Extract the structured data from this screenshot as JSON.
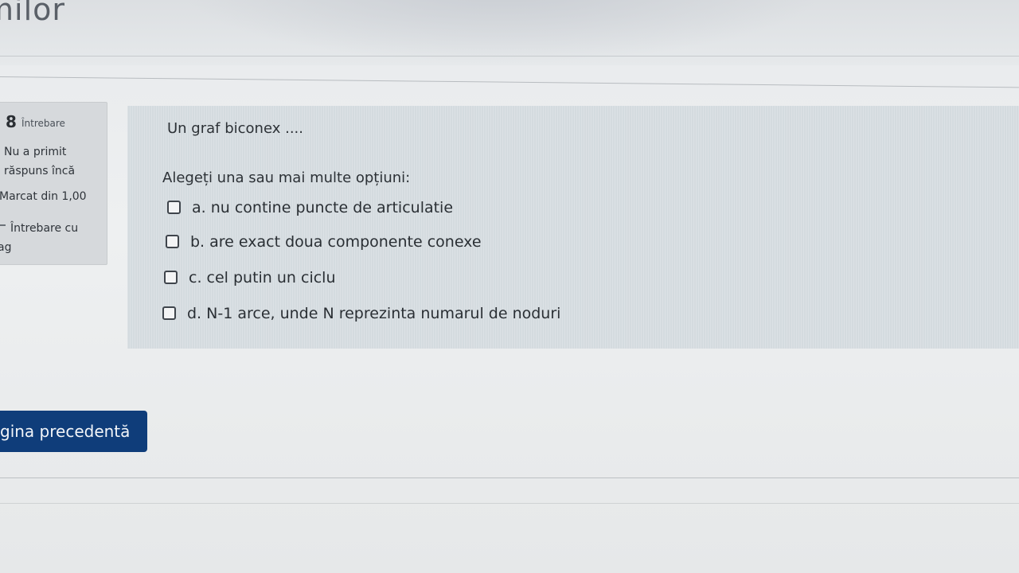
{
  "header": {
    "title": "milor"
  },
  "question_info": {
    "number": "8",
    "number_word": "Întrebare",
    "state_line1": "Nu a primit",
    "state_line2": "răspuns încă",
    "grade": "Marcat din 1,00",
    "flag_line1": "Întrebare cu",
    "flag_line2": "ag"
  },
  "question": {
    "text": "Un graf biconex ....",
    "prompt": "Alegeți una sau mai multe opțiuni:",
    "options": [
      {
        "label": "a. nu contine puncte de articulatie",
        "checked": false
      },
      {
        "label": "b. are exact doua componente conexe",
        "checked": false
      },
      {
        "label": "c. cel putin un ciclu",
        "checked": false
      },
      {
        "label": "d. N-1 arce, unde N reprezinta numarul de noduri",
        "checked": false
      }
    ]
  },
  "navigation": {
    "prev_label": "gina precedentă"
  },
  "colors": {
    "primary_button": "#0f3d7a",
    "question_bg": "#d4dbdf",
    "info_bg": "#d6d9dc"
  }
}
